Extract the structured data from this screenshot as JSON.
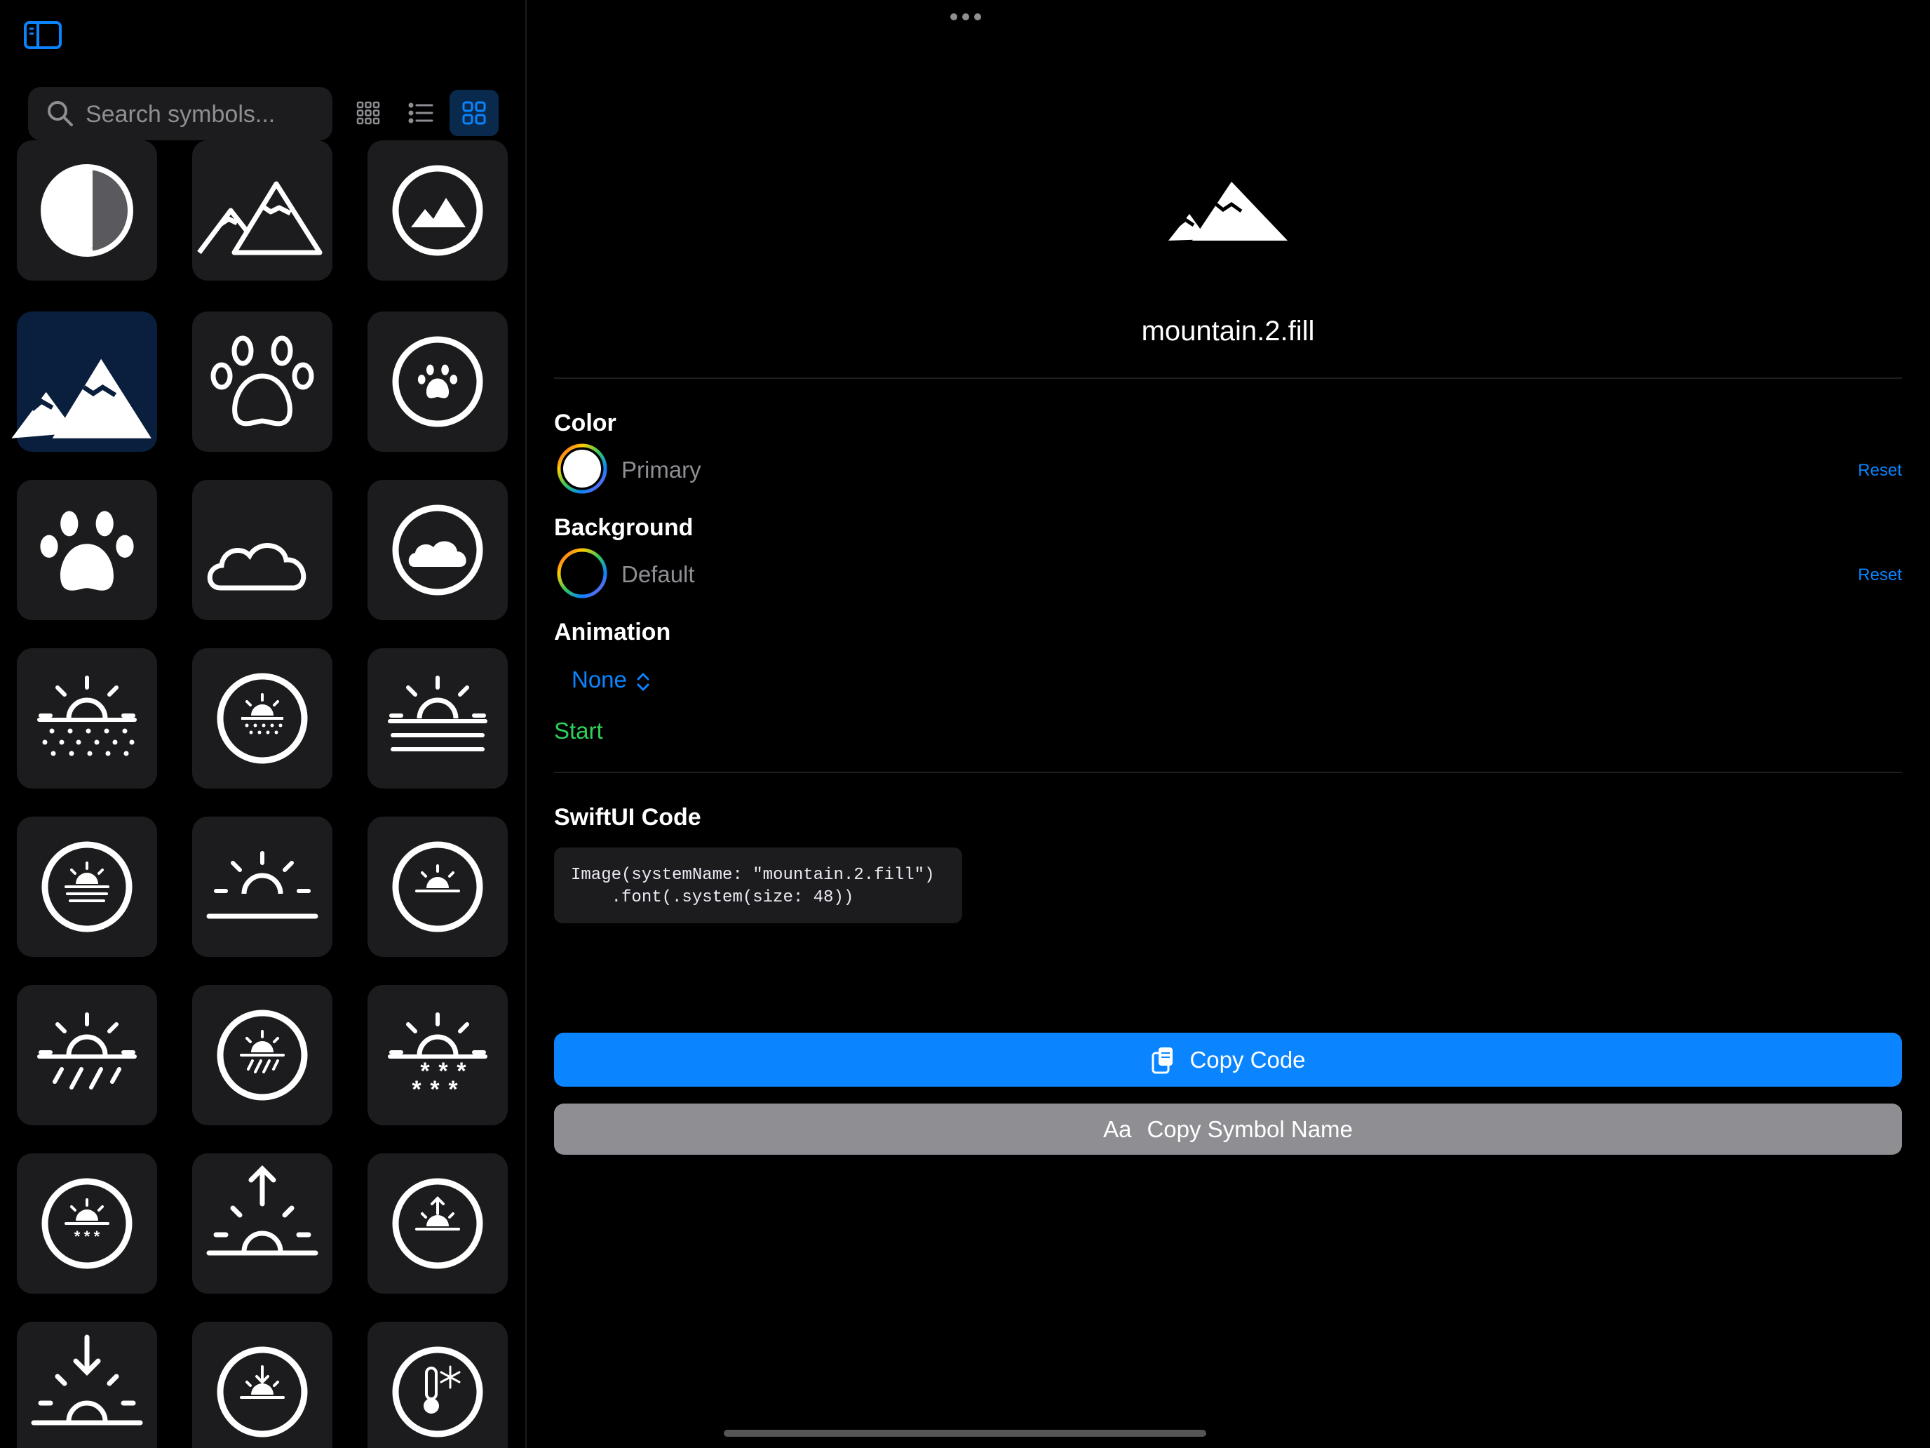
{
  "sidebar": {
    "search": {
      "placeholder": "Search symbols..."
    },
    "view_modes": [
      "small-grid",
      "list",
      "large-grid"
    ],
    "active_view_mode": "large-grid",
    "symbols": [
      "moon-half-icon",
      "mountain-2-icon",
      "mountain-circle-icon",
      "mountain-2-fill-icon",
      "pawprint-icon",
      "pawprint-circle-fill-icon",
      "pawprint-fill-icon",
      "cloud-2-icon",
      "cloud-circle-fill-icon",
      "sun-dust-icon",
      "sun-dust-circle-icon",
      "sun-haze-icon",
      "sun-haze-circle-icon",
      "sun-horizon-icon",
      "sun-horizon-circle-icon",
      "sun-rain-icon",
      "sun-rain-circle-icon",
      "sun-snow-icon",
      "sun-snow-circle-icon",
      "sunrise-icon",
      "sunrise-circle-icon",
      "sunset-icon",
      "sunset-circle-icon",
      "thermometer-snowflake-circle-icon"
    ],
    "selected_symbol": "mountain-2-fill-icon"
  },
  "detail": {
    "symbol_name": "mountain.2.fill",
    "color": {
      "label": "Color",
      "value": "Primary",
      "reset": "Reset",
      "swatch": "#ffffff"
    },
    "background": {
      "label": "Background",
      "value": "Default",
      "reset": "Reset"
    },
    "animation": {
      "label": "Animation",
      "value": "None",
      "start": "Start"
    },
    "code": {
      "label": "SwiftUI Code",
      "text": "Image(systemName: \"mountain.2.fill\")\n    .font(.system(size: 48))"
    },
    "copy_code": {
      "label": "Copy Code"
    },
    "copy_name": {
      "prefix": "Aa",
      "label": "Copy Symbol Name"
    }
  },
  "colors": {
    "accent": "#0a84ff",
    "start": "#30d158",
    "tile": "#1c1c1e",
    "secondary_button": "#8e8e93"
  }
}
